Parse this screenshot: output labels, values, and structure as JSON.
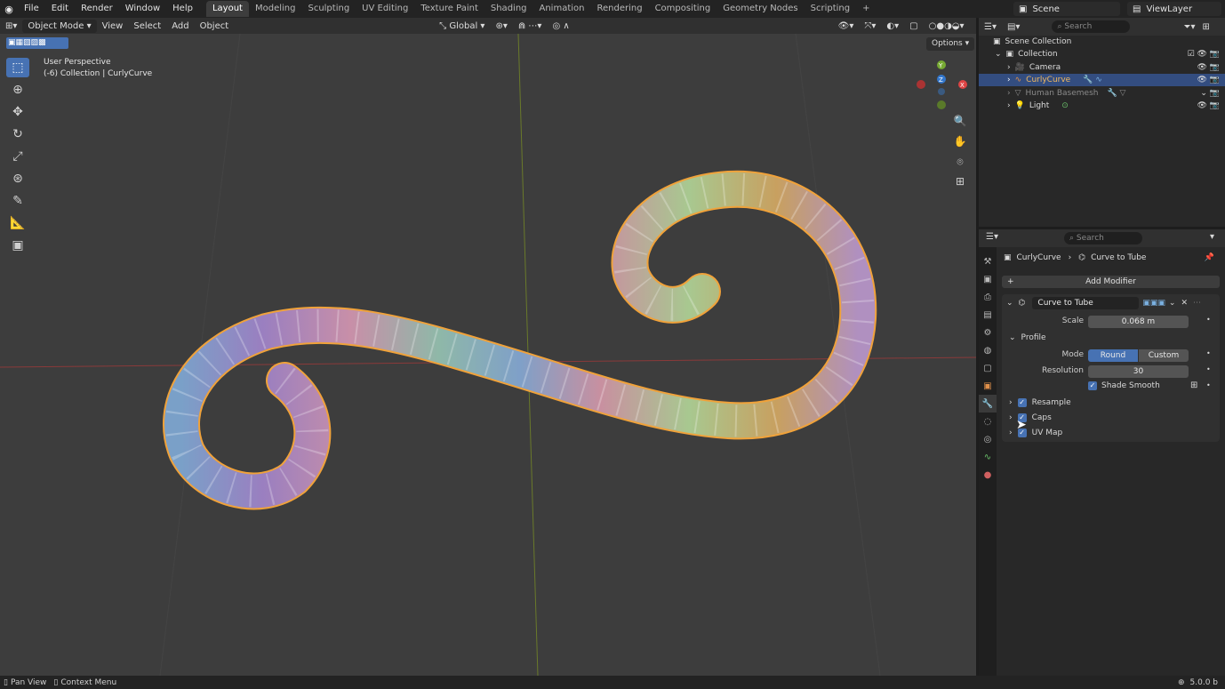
{
  "topbar": {
    "menus": [
      "File",
      "Edit",
      "Render",
      "Window",
      "Help"
    ],
    "workspaces": [
      "Layout",
      "Modeling",
      "Sculpting",
      "UV Editing",
      "Texture Paint",
      "Shading",
      "Animation",
      "Rendering",
      "Compositing",
      "Geometry Nodes",
      "Scripting"
    ],
    "active_workspace": "Layout",
    "add_tab": "+",
    "scene": "Scene",
    "view_layer": "ViewLayer"
  },
  "viewport_header": {
    "mode": "Object Mode",
    "menus": [
      "View",
      "Select",
      "Add",
      "Object"
    ],
    "orientation": "Global",
    "options": "Options"
  },
  "viewport": {
    "perspective": "User Perspective",
    "collection_line": "(-6) Collection | CurlyCurve",
    "gizmo_axes": [
      "Y",
      "Z",
      "X"
    ]
  },
  "outliner": {
    "search_placeholder": "Search",
    "rows": [
      {
        "label": "Scene Collection"
      },
      {
        "label": "Collection"
      },
      {
        "label": "Camera"
      },
      {
        "label": "CurlyCurve"
      },
      {
        "label": "Human Basemesh"
      },
      {
        "label": "Light"
      }
    ]
  },
  "properties": {
    "search_placeholder": "Search",
    "breadcrumb_object": "CurlyCurve",
    "breadcrumb_modifier": "Curve to Tube",
    "add_modifier": "Add Modifier",
    "modifier_name": "Curve to Tube",
    "scale_label": "Scale",
    "scale_value": "0.068 m",
    "profile_label": "Profile",
    "mode_label": "Mode",
    "mode_round": "Round",
    "mode_custom": "Custom",
    "resolution_label": "Resolution",
    "resolution_value": "30",
    "shade_smooth": "Shade Smooth",
    "resample": "Resample",
    "caps": "Caps",
    "uv_map": "UV Map"
  },
  "statusbar": {
    "pan_view": "Pan View",
    "context_menu": "Context Menu",
    "version": "5.0.0 b"
  },
  "colors": {
    "accent": "#4772b3",
    "selected_row": "#334d80",
    "viewport_bg": "#3d3d3d",
    "outline": "#f0a23a"
  }
}
